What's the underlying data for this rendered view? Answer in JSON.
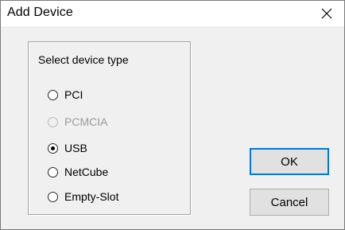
{
  "window": {
    "title": "Add Device",
    "close_glyph": "✕"
  },
  "group": {
    "legend": "Select device type",
    "options": [
      {
        "label": "PCI",
        "checked": false,
        "enabled": true
      },
      {
        "label": "PCMCIA",
        "checked": false,
        "enabled": false
      },
      {
        "label": "USB",
        "checked": true,
        "enabled": true
      },
      {
        "label": "NetCube",
        "checked": false,
        "enabled": true
      },
      {
        "label": "Empty-Slot",
        "checked": false,
        "enabled": true
      }
    ]
  },
  "buttons": {
    "ok_label": "OK",
    "cancel_label": "Cancel"
  },
  "colors": {
    "default_button_border": "#0078d7",
    "disabled_text": "#9a9a9a"
  },
  "icons": {
    "close": "close-icon"
  }
}
